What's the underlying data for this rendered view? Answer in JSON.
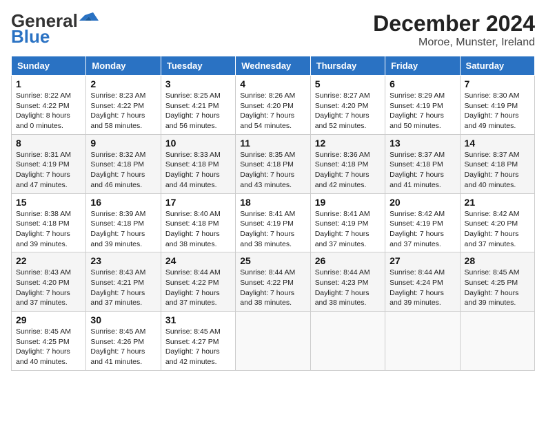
{
  "header": {
    "logo_general": "General",
    "logo_blue": "Blue",
    "month": "December 2024",
    "location": "Moroe, Munster, Ireland"
  },
  "weekdays": [
    "Sunday",
    "Monday",
    "Tuesday",
    "Wednesday",
    "Thursday",
    "Friday",
    "Saturday"
  ],
  "weeks": [
    [
      {
        "day": 1,
        "sunrise": "8:22 AM",
        "sunset": "4:22 PM",
        "daylight": "8 hours and 0 minutes"
      },
      {
        "day": 2,
        "sunrise": "8:23 AM",
        "sunset": "4:22 PM",
        "daylight": "7 hours and 58 minutes"
      },
      {
        "day": 3,
        "sunrise": "8:25 AM",
        "sunset": "4:21 PM",
        "daylight": "7 hours and 56 minutes"
      },
      {
        "day": 4,
        "sunrise": "8:26 AM",
        "sunset": "4:20 PM",
        "daylight": "7 hours and 54 minutes"
      },
      {
        "day": 5,
        "sunrise": "8:27 AM",
        "sunset": "4:20 PM",
        "daylight": "7 hours and 52 minutes"
      },
      {
        "day": 6,
        "sunrise": "8:29 AM",
        "sunset": "4:19 PM",
        "daylight": "7 hours and 50 minutes"
      },
      {
        "day": 7,
        "sunrise": "8:30 AM",
        "sunset": "4:19 PM",
        "daylight": "7 hours and 49 minutes"
      }
    ],
    [
      {
        "day": 8,
        "sunrise": "8:31 AM",
        "sunset": "4:19 PM",
        "daylight": "7 hours and 47 minutes"
      },
      {
        "day": 9,
        "sunrise": "8:32 AM",
        "sunset": "4:18 PM",
        "daylight": "7 hours and 46 minutes"
      },
      {
        "day": 10,
        "sunrise": "8:33 AM",
        "sunset": "4:18 PM",
        "daylight": "7 hours and 44 minutes"
      },
      {
        "day": 11,
        "sunrise": "8:35 AM",
        "sunset": "4:18 PM",
        "daylight": "7 hours and 43 minutes"
      },
      {
        "day": 12,
        "sunrise": "8:36 AM",
        "sunset": "4:18 PM",
        "daylight": "7 hours and 42 minutes"
      },
      {
        "day": 13,
        "sunrise": "8:37 AM",
        "sunset": "4:18 PM",
        "daylight": "7 hours and 41 minutes"
      },
      {
        "day": 14,
        "sunrise": "8:37 AM",
        "sunset": "4:18 PM",
        "daylight": "7 hours and 40 minutes"
      }
    ],
    [
      {
        "day": 15,
        "sunrise": "8:38 AM",
        "sunset": "4:18 PM",
        "daylight": "7 hours and 39 minutes"
      },
      {
        "day": 16,
        "sunrise": "8:39 AM",
        "sunset": "4:18 PM",
        "daylight": "7 hours and 39 minutes"
      },
      {
        "day": 17,
        "sunrise": "8:40 AM",
        "sunset": "4:18 PM",
        "daylight": "7 hours and 38 minutes"
      },
      {
        "day": 18,
        "sunrise": "8:41 AM",
        "sunset": "4:19 PM",
        "daylight": "7 hours and 38 minutes"
      },
      {
        "day": 19,
        "sunrise": "8:41 AM",
        "sunset": "4:19 PM",
        "daylight": "7 hours and 37 minutes"
      },
      {
        "day": 20,
        "sunrise": "8:42 AM",
        "sunset": "4:19 PM",
        "daylight": "7 hours and 37 minutes"
      },
      {
        "day": 21,
        "sunrise": "8:42 AM",
        "sunset": "4:20 PM",
        "daylight": "7 hours and 37 minutes"
      }
    ],
    [
      {
        "day": 22,
        "sunrise": "8:43 AM",
        "sunset": "4:20 PM",
        "daylight": "7 hours and 37 minutes"
      },
      {
        "day": 23,
        "sunrise": "8:43 AM",
        "sunset": "4:21 PM",
        "daylight": "7 hours and 37 minutes"
      },
      {
        "day": 24,
        "sunrise": "8:44 AM",
        "sunset": "4:22 PM",
        "daylight": "7 hours and 37 minutes"
      },
      {
        "day": 25,
        "sunrise": "8:44 AM",
        "sunset": "4:22 PM",
        "daylight": "7 hours and 38 minutes"
      },
      {
        "day": 26,
        "sunrise": "8:44 AM",
        "sunset": "4:23 PM",
        "daylight": "7 hours and 38 minutes"
      },
      {
        "day": 27,
        "sunrise": "8:44 AM",
        "sunset": "4:24 PM",
        "daylight": "7 hours and 39 minutes"
      },
      {
        "day": 28,
        "sunrise": "8:45 AM",
        "sunset": "4:25 PM",
        "daylight": "7 hours and 39 minutes"
      }
    ],
    [
      {
        "day": 29,
        "sunrise": "8:45 AM",
        "sunset": "4:25 PM",
        "daylight": "7 hours and 40 minutes"
      },
      {
        "day": 30,
        "sunrise": "8:45 AM",
        "sunset": "4:26 PM",
        "daylight": "7 hours and 41 minutes"
      },
      {
        "day": 31,
        "sunrise": "8:45 AM",
        "sunset": "4:27 PM",
        "daylight": "7 hours and 42 minutes"
      },
      null,
      null,
      null,
      null
    ]
  ]
}
